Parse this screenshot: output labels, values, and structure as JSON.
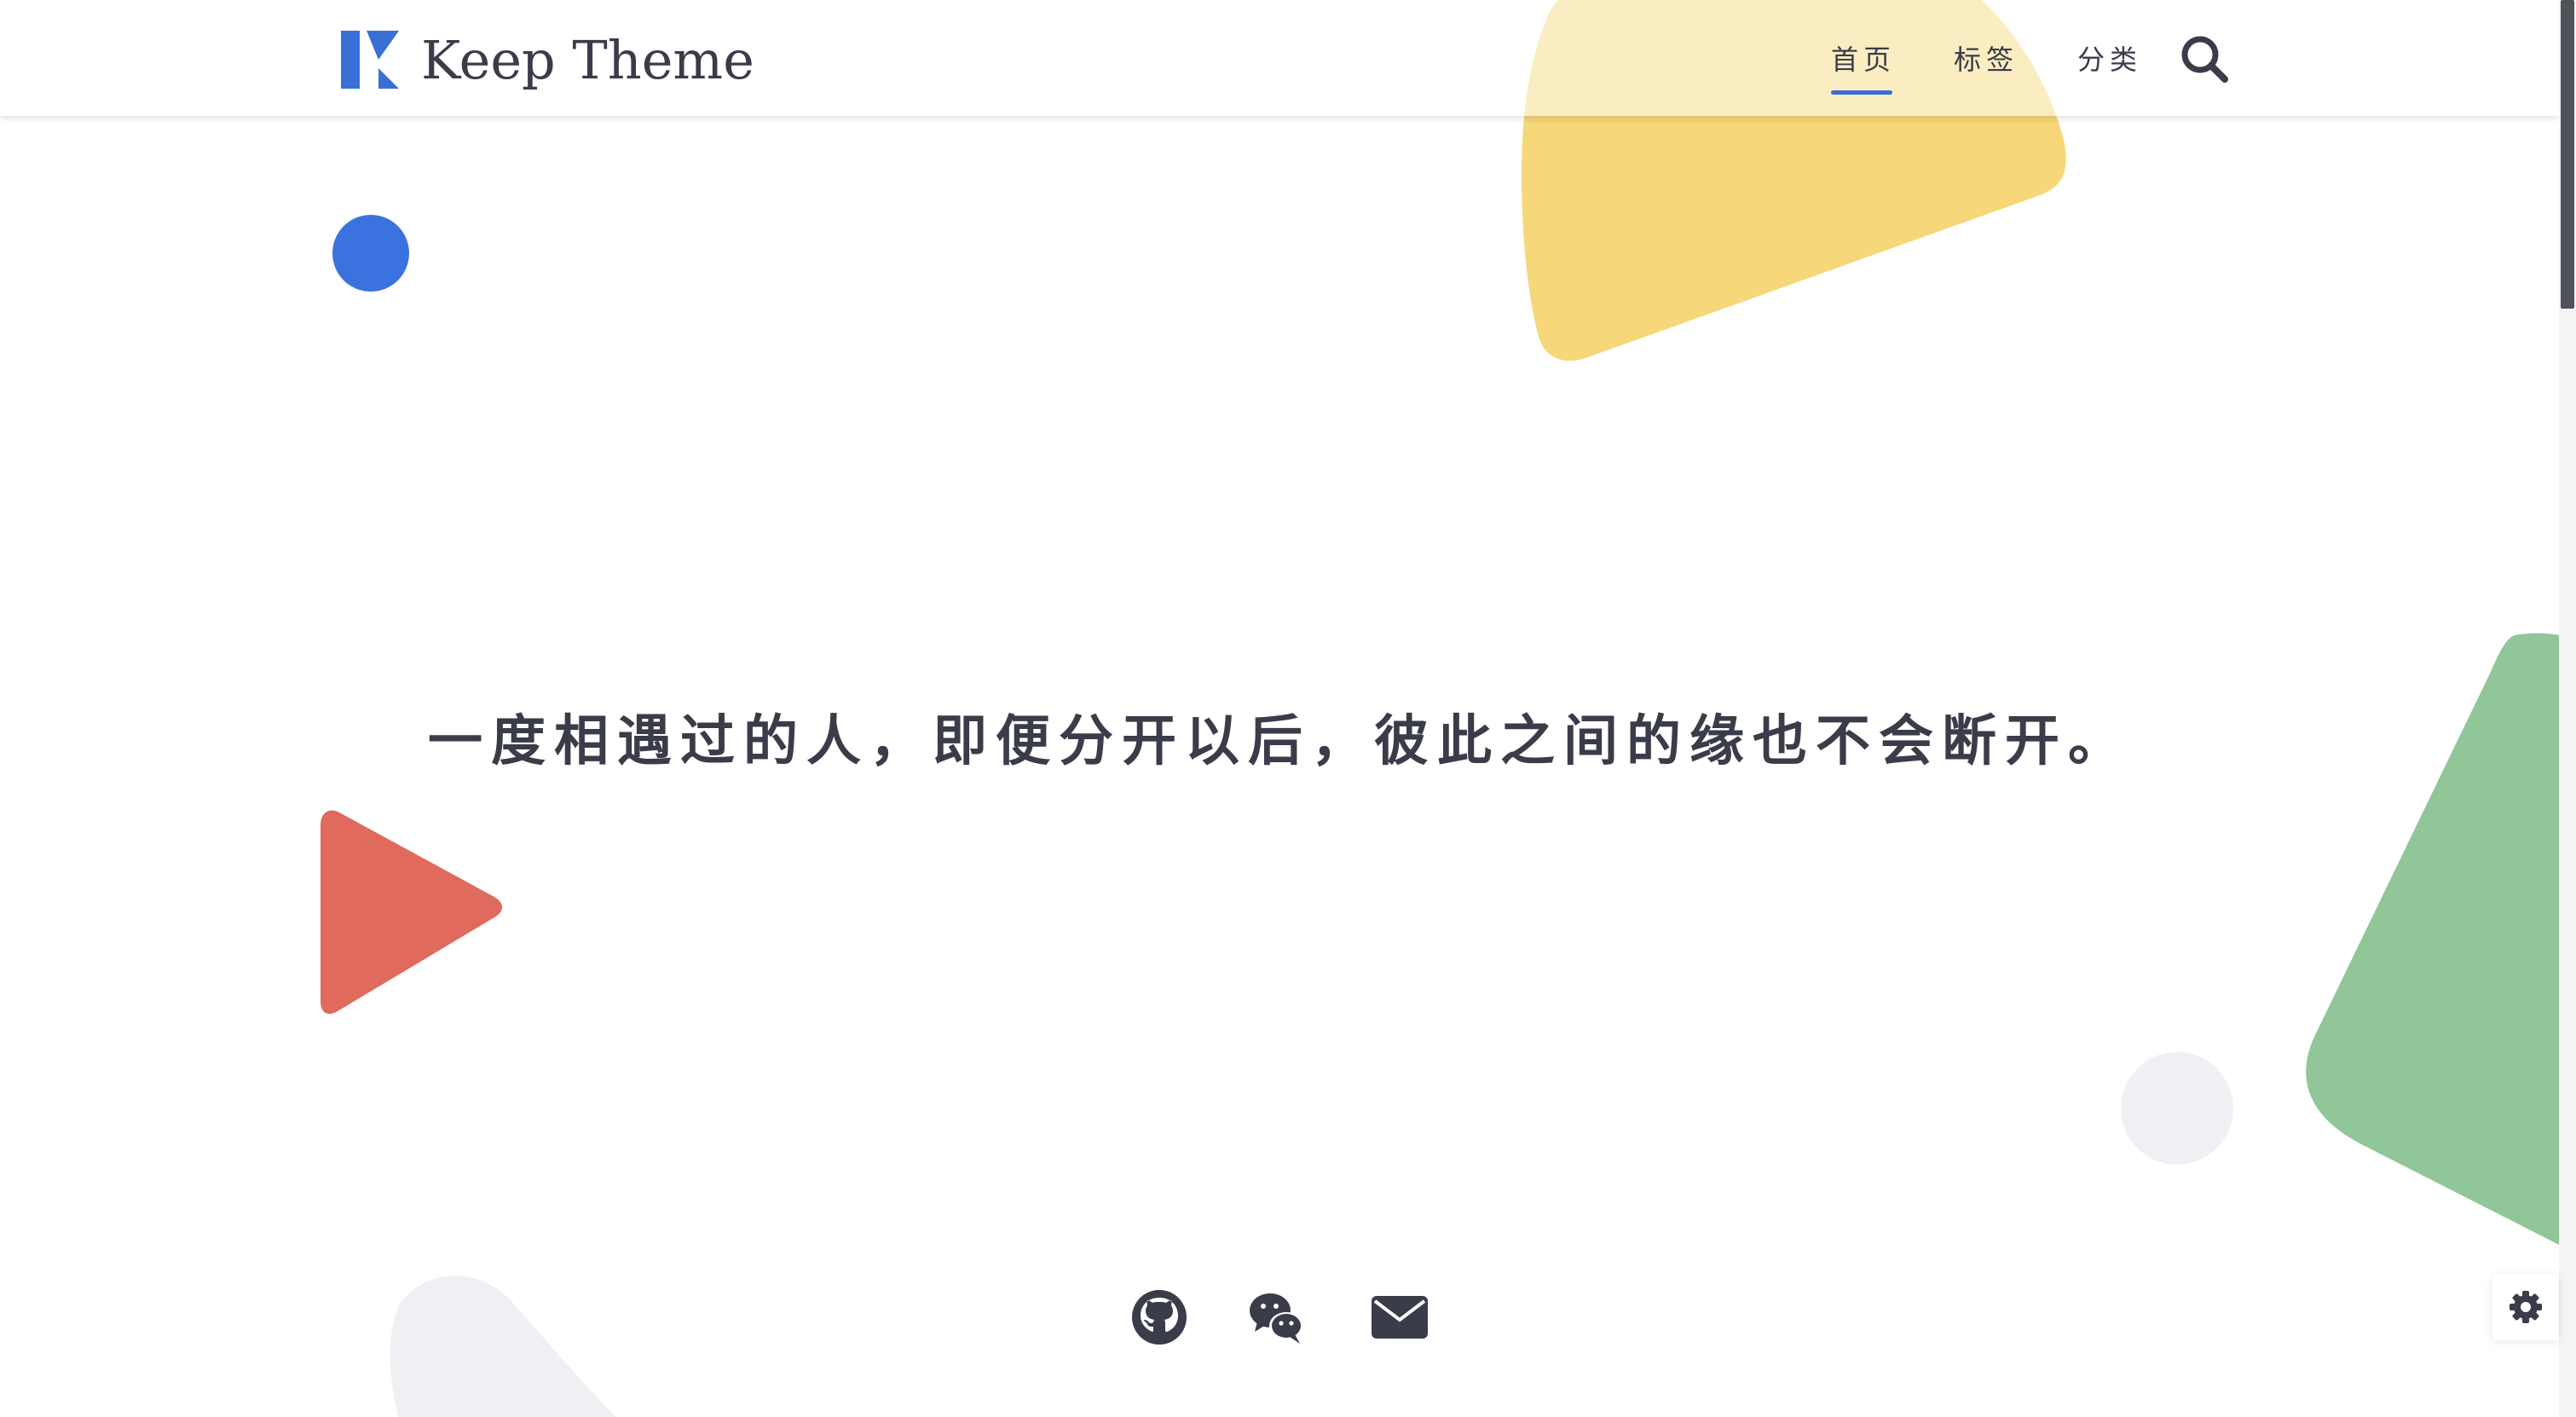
{
  "header": {
    "site_title": "Keep Theme",
    "logo_icon": "keep-k-logo",
    "nav": [
      {
        "label": "首页",
        "active": true
      },
      {
        "label": "标签",
        "active": false
      },
      {
        "label": "分类",
        "active": false
      }
    ],
    "search_icon": "search-icon"
  },
  "main": {
    "quote": "一度相遇过的人，即便分开以后，彼此之间的缘也不会断开。"
  },
  "social": [
    {
      "icon": "github-icon"
    },
    {
      "icon": "wechat-icon"
    },
    {
      "icon": "email-icon"
    }
  ],
  "settings": {
    "icon": "gear-icon"
  },
  "colors": {
    "text": "#3a3c4a",
    "accent": "#3a6fd6",
    "yellow": "#f6d572",
    "red": "#e06a5e",
    "green": "#90c698",
    "blue": "#3a72e0",
    "grey": "#eff0f3"
  }
}
